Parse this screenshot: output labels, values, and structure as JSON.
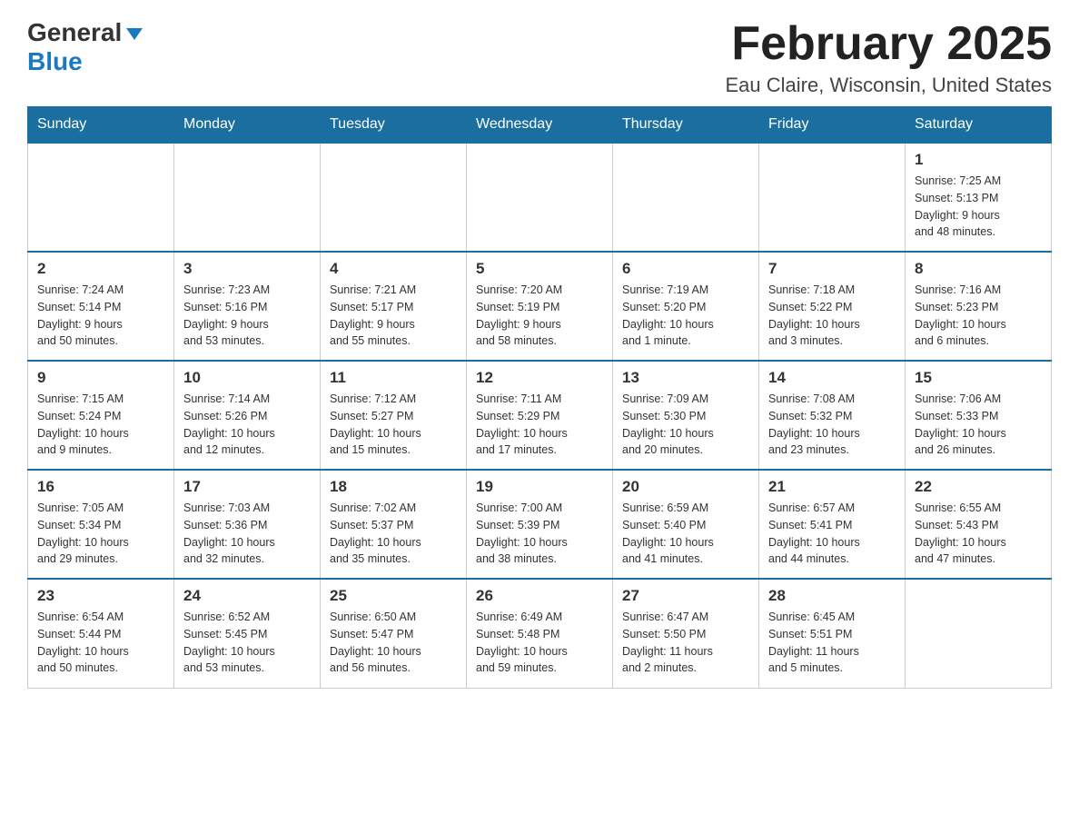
{
  "header": {
    "logo": {
      "general": "General",
      "blue": "Blue"
    },
    "title": "February 2025",
    "location": "Eau Claire, Wisconsin, United States"
  },
  "weekdays": [
    "Sunday",
    "Monday",
    "Tuesday",
    "Wednesday",
    "Thursday",
    "Friday",
    "Saturday"
  ],
  "weeks": [
    [
      {
        "day": "",
        "info": ""
      },
      {
        "day": "",
        "info": ""
      },
      {
        "day": "",
        "info": ""
      },
      {
        "day": "",
        "info": ""
      },
      {
        "day": "",
        "info": ""
      },
      {
        "day": "",
        "info": ""
      },
      {
        "day": "1",
        "info": "Sunrise: 7:25 AM\nSunset: 5:13 PM\nDaylight: 9 hours\nand 48 minutes."
      }
    ],
    [
      {
        "day": "2",
        "info": "Sunrise: 7:24 AM\nSunset: 5:14 PM\nDaylight: 9 hours\nand 50 minutes."
      },
      {
        "day": "3",
        "info": "Sunrise: 7:23 AM\nSunset: 5:16 PM\nDaylight: 9 hours\nand 53 minutes."
      },
      {
        "day": "4",
        "info": "Sunrise: 7:21 AM\nSunset: 5:17 PM\nDaylight: 9 hours\nand 55 minutes."
      },
      {
        "day": "5",
        "info": "Sunrise: 7:20 AM\nSunset: 5:19 PM\nDaylight: 9 hours\nand 58 minutes."
      },
      {
        "day": "6",
        "info": "Sunrise: 7:19 AM\nSunset: 5:20 PM\nDaylight: 10 hours\nand 1 minute."
      },
      {
        "day": "7",
        "info": "Sunrise: 7:18 AM\nSunset: 5:22 PM\nDaylight: 10 hours\nand 3 minutes."
      },
      {
        "day": "8",
        "info": "Sunrise: 7:16 AM\nSunset: 5:23 PM\nDaylight: 10 hours\nand 6 minutes."
      }
    ],
    [
      {
        "day": "9",
        "info": "Sunrise: 7:15 AM\nSunset: 5:24 PM\nDaylight: 10 hours\nand 9 minutes."
      },
      {
        "day": "10",
        "info": "Sunrise: 7:14 AM\nSunset: 5:26 PM\nDaylight: 10 hours\nand 12 minutes."
      },
      {
        "day": "11",
        "info": "Sunrise: 7:12 AM\nSunset: 5:27 PM\nDaylight: 10 hours\nand 15 minutes."
      },
      {
        "day": "12",
        "info": "Sunrise: 7:11 AM\nSunset: 5:29 PM\nDaylight: 10 hours\nand 17 minutes."
      },
      {
        "day": "13",
        "info": "Sunrise: 7:09 AM\nSunset: 5:30 PM\nDaylight: 10 hours\nand 20 minutes."
      },
      {
        "day": "14",
        "info": "Sunrise: 7:08 AM\nSunset: 5:32 PM\nDaylight: 10 hours\nand 23 minutes."
      },
      {
        "day": "15",
        "info": "Sunrise: 7:06 AM\nSunset: 5:33 PM\nDaylight: 10 hours\nand 26 minutes."
      }
    ],
    [
      {
        "day": "16",
        "info": "Sunrise: 7:05 AM\nSunset: 5:34 PM\nDaylight: 10 hours\nand 29 minutes."
      },
      {
        "day": "17",
        "info": "Sunrise: 7:03 AM\nSunset: 5:36 PM\nDaylight: 10 hours\nand 32 minutes."
      },
      {
        "day": "18",
        "info": "Sunrise: 7:02 AM\nSunset: 5:37 PM\nDaylight: 10 hours\nand 35 minutes."
      },
      {
        "day": "19",
        "info": "Sunrise: 7:00 AM\nSunset: 5:39 PM\nDaylight: 10 hours\nand 38 minutes."
      },
      {
        "day": "20",
        "info": "Sunrise: 6:59 AM\nSunset: 5:40 PM\nDaylight: 10 hours\nand 41 minutes."
      },
      {
        "day": "21",
        "info": "Sunrise: 6:57 AM\nSunset: 5:41 PM\nDaylight: 10 hours\nand 44 minutes."
      },
      {
        "day": "22",
        "info": "Sunrise: 6:55 AM\nSunset: 5:43 PM\nDaylight: 10 hours\nand 47 minutes."
      }
    ],
    [
      {
        "day": "23",
        "info": "Sunrise: 6:54 AM\nSunset: 5:44 PM\nDaylight: 10 hours\nand 50 minutes."
      },
      {
        "day": "24",
        "info": "Sunrise: 6:52 AM\nSunset: 5:45 PM\nDaylight: 10 hours\nand 53 minutes."
      },
      {
        "day": "25",
        "info": "Sunrise: 6:50 AM\nSunset: 5:47 PM\nDaylight: 10 hours\nand 56 minutes."
      },
      {
        "day": "26",
        "info": "Sunrise: 6:49 AM\nSunset: 5:48 PM\nDaylight: 10 hours\nand 59 minutes."
      },
      {
        "day": "27",
        "info": "Sunrise: 6:47 AM\nSunset: 5:50 PM\nDaylight: 11 hours\nand 2 minutes."
      },
      {
        "day": "28",
        "info": "Sunrise: 6:45 AM\nSunset: 5:51 PM\nDaylight: 11 hours\nand 5 minutes."
      },
      {
        "day": "",
        "info": ""
      }
    ]
  ]
}
